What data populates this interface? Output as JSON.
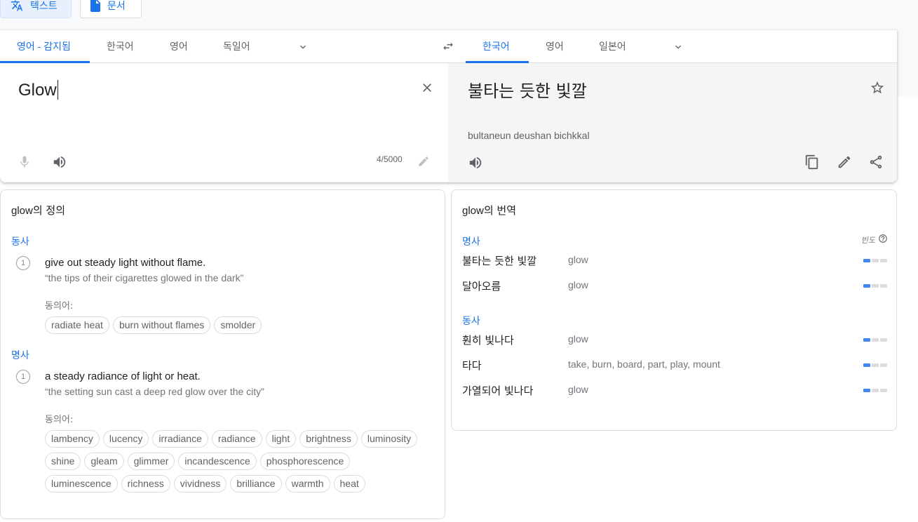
{
  "modes": {
    "text_label": "텍스트",
    "document_label": "문서"
  },
  "source_languages": [
    "영어 - 감지됨",
    "한국어",
    "영어",
    "독일어"
  ],
  "target_languages": [
    "한국어",
    "영어",
    "일본어"
  ],
  "source": {
    "text": "Glow",
    "char_count": "4/5000"
  },
  "target": {
    "text": "불타는 듯한 빛깔",
    "romanization": "bultaneun deushan bichkkal"
  },
  "definitions": {
    "title_word": "glow",
    "title_suffix": "의 정의",
    "synonyms_label": "동의어:",
    "entries": [
      {
        "pos": "동사",
        "number": "1",
        "gloss": "give out steady light without flame.",
        "example": "“the tips of their cigarettes glowed in the dark”",
        "synonyms": [
          "radiate heat",
          "burn without flames",
          "smolder"
        ]
      },
      {
        "pos": "명사",
        "number": "1",
        "gloss": "a steady radiance of light or heat.",
        "example": "“the setting sun cast a deep red glow over the city”",
        "synonyms": [
          "lambency",
          "lucency",
          "irradiance",
          "radiance",
          "light",
          "brightness",
          "luminosity",
          "shine",
          "gleam",
          "glimmer",
          "incandescence",
          "phosphorescence",
          "luminescence",
          "richness",
          "vividness",
          "brilliance",
          "warmth",
          "heat"
        ]
      }
    ]
  },
  "translations": {
    "title_word": "glow",
    "title_suffix": "의 번역",
    "frequency_label": "빈도",
    "groups": [
      {
        "pos": "명사",
        "rows": [
          {
            "word": "불타는 듯한 빛깔",
            "back": "glow",
            "freq": 1
          },
          {
            "word": "달아오름",
            "back": "glow",
            "freq": 1
          }
        ]
      },
      {
        "pos": "동사",
        "rows": [
          {
            "word": "훤히 빛나다",
            "back": "glow",
            "freq": 1
          },
          {
            "word": "타다",
            "back": "take, burn, board, part, play, mount",
            "freq": 1
          },
          {
            "word": "가열되어 빛나다",
            "back": "glow",
            "freq": 1
          }
        ]
      }
    ]
  },
  "colors": {
    "accent": "#1a73e8",
    "freq_on": "#4285f4",
    "freq_off": "#dadce0"
  }
}
